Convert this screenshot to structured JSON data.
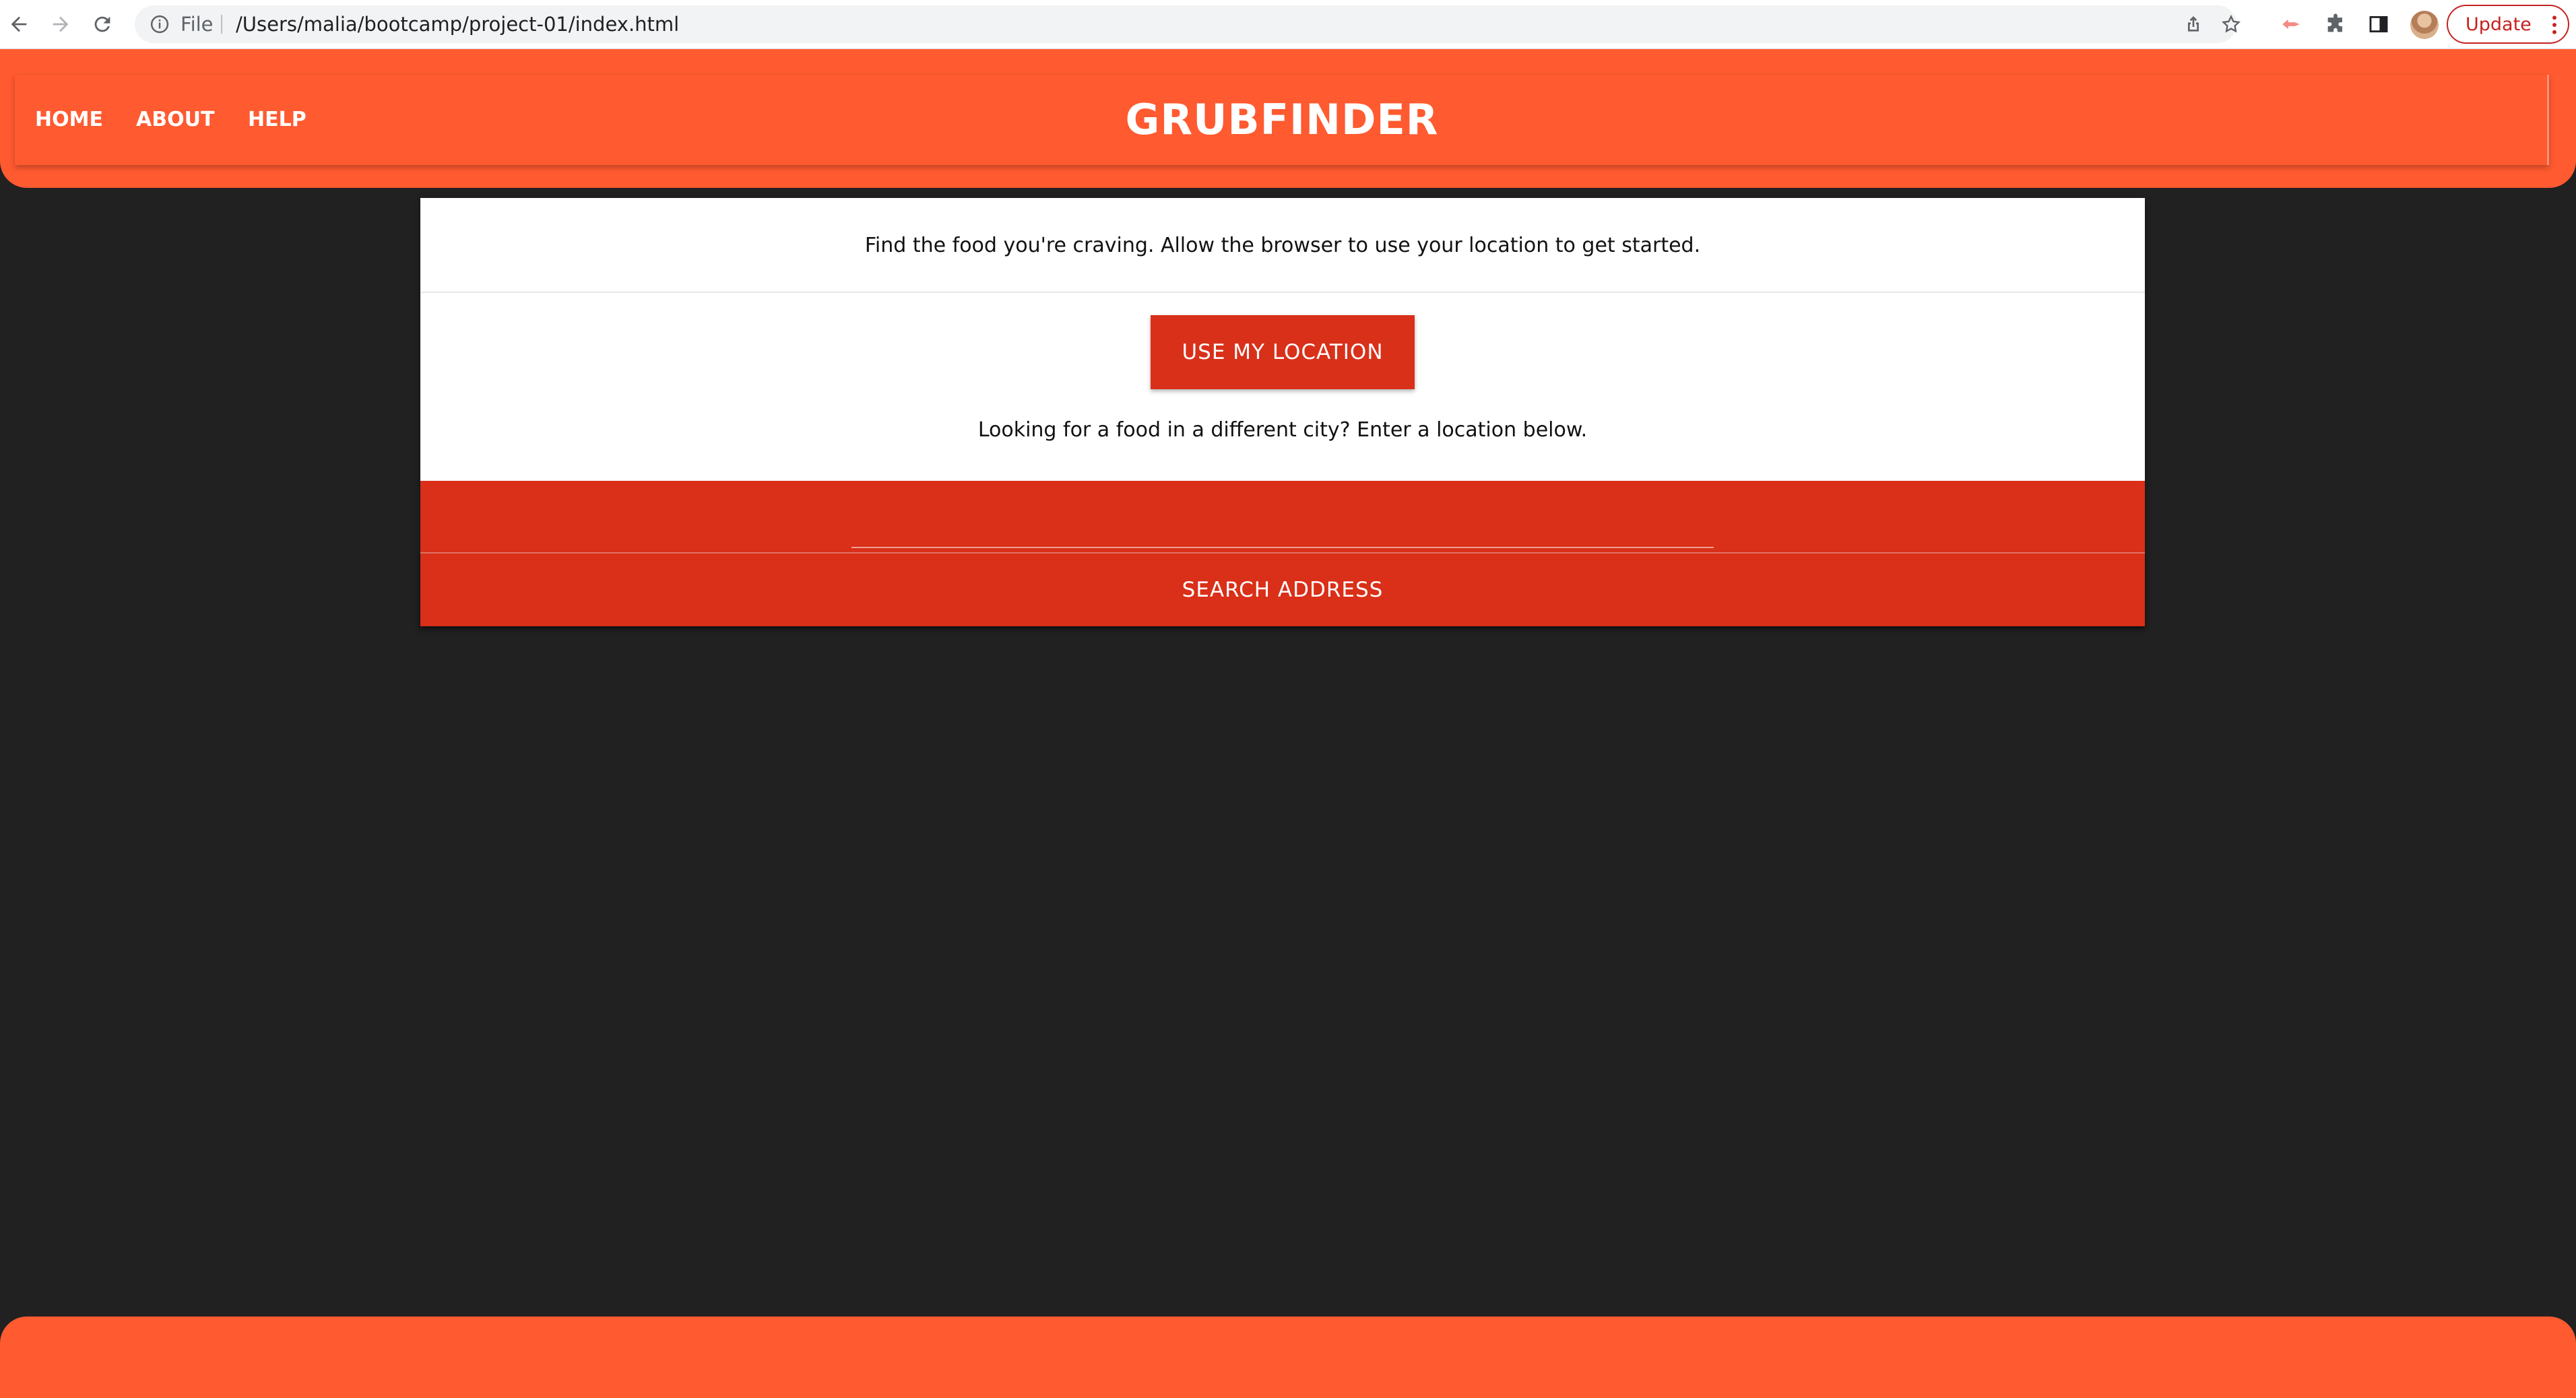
{
  "browser": {
    "scheme_label": "File",
    "url": "/Users/malia/bootcamp/project-01/index.html",
    "update_label": "Update",
    "icons": [
      "back-icon",
      "forward-icon",
      "reload-icon",
      "info-icon",
      "share-icon",
      "star-icon",
      "extension-icon",
      "puzzle-icon",
      "sidepanel-icon",
      "avatar",
      "more-icon"
    ]
  },
  "nav": {
    "links": [
      "HOME",
      "ABOUT",
      "HELP"
    ],
    "brand": "GRUBFINDER"
  },
  "main": {
    "intro": "Find the food you're craving. Allow the browser to use your location to get started.",
    "location_button": "USE MY LOCATION",
    "alt_prompt": "Looking for a food in a different city? Enter a location below.",
    "address_value": "",
    "address_placeholder": "",
    "search_button": "SEARCH ADDRESS"
  },
  "colors": {
    "header": "#ff5a30",
    "accent_button": "#d9301a",
    "background": "#212121",
    "card": "#ffffff"
  }
}
